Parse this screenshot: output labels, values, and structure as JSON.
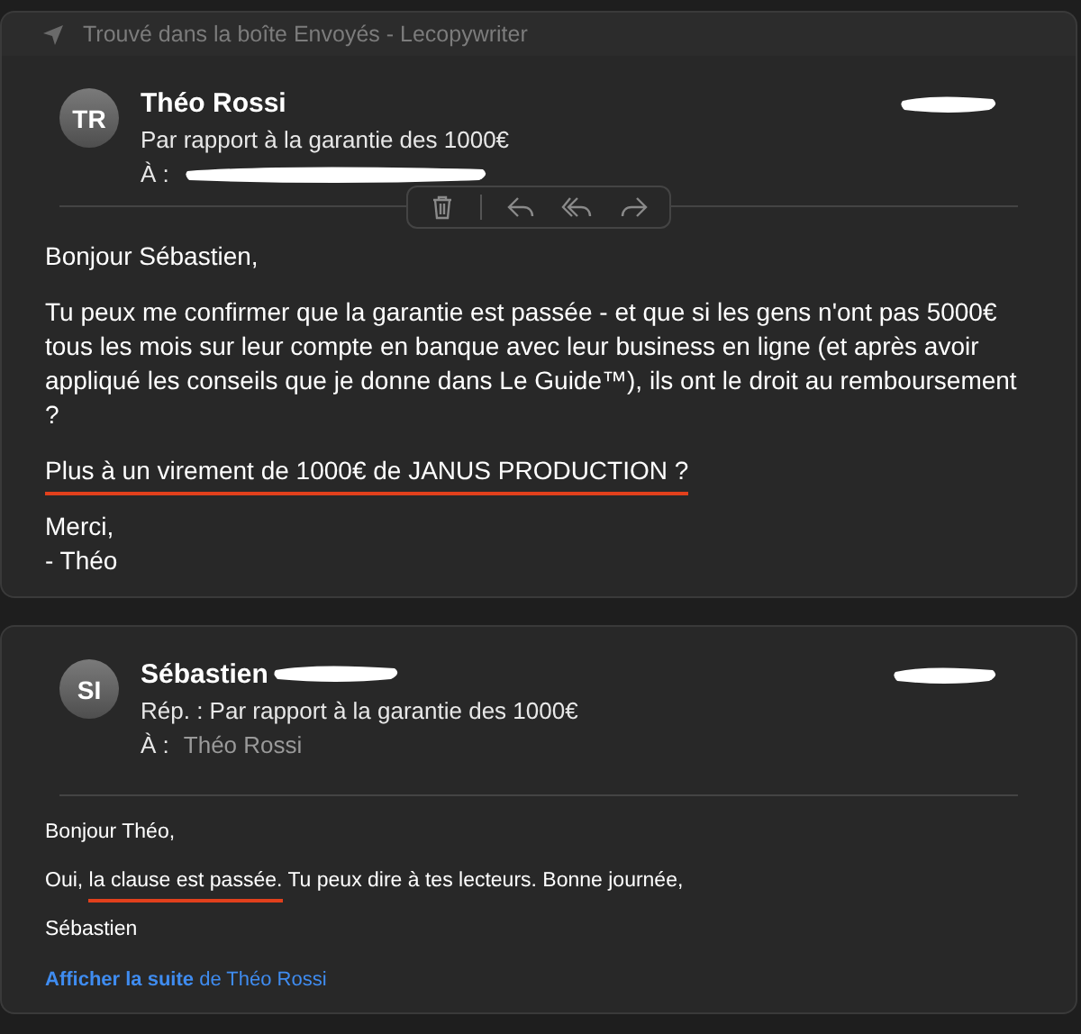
{
  "banner": {
    "text": "Trouvé dans la boîte Envoyés - Lecopywriter"
  },
  "messages": [
    {
      "kind": "original",
      "initials": "TR",
      "sender": "Théo Rossi",
      "sender_redacted": false,
      "subject": "Par rapport à la garantie des 1000€",
      "to_label": "À :",
      "recipient_redacted": true,
      "date_redacted": true,
      "toolbar": [
        {
          "kind": "delete"
        },
        {
          "kind": "reply"
        },
        {
          "kind": "reply_all"
        },
        {
          "kind": "forward"
        }
      ],
      "paragraphs": [
        [
          {
            "text": "Bonjour Sébastien,",
            "underlined": false
          }
        ],
        [
          {
            "text": "Tu peux me confirmer que la garantie est passée - et que si les gens n'ont pas 5000€ tous les mois sur leur compte en banque avec leur business en ligne (et après avoir appliqué les conseils que je donne dans Le Guide™), ils ont le droit au remboursement ?",
            "underlined": false
          }
        ],
        [
          {
            "text": "Plus à un virement de 1000€ de JANUS PRODUCTION ?",
            "underlined": true
          }
        ],
        [
          {
            "text": "Merci,\n- Théo",
            "underlined": false
          }
        ]
      ]
    },
    {
      "kind": "reply",
      "initials": "SI",
      "sender": "Sébastien",
      "sender_redacted": true,
      "subject": "Rép. : Par rapport à la garantie des 1000€",
      "to_label": "À :",
      "to": "Théo Rossi",
      "recipient_redacted": false,
      "date_redacted": true,
      "paragraphs": [
        [
          {
            "text": "Bonjour Théo,",
            "underlined": false
          }
        ],
        [
          {
            "text": "Oui, ",
            "underlined": false
          },
          {
            "text": "la clause est passée.",
            "underlined": true
          },
          {
            "text": " Tu peux dire à tes lecteurs. Bonne journée,",
            "underlined": false
          }
        ],
        [
          {
            "text": "Sébastien",
            "underlined": false
          }
        ]
      ],
      "more_link": "**Afficher la suite** de Théo Rossi"
    }
  ]
}
